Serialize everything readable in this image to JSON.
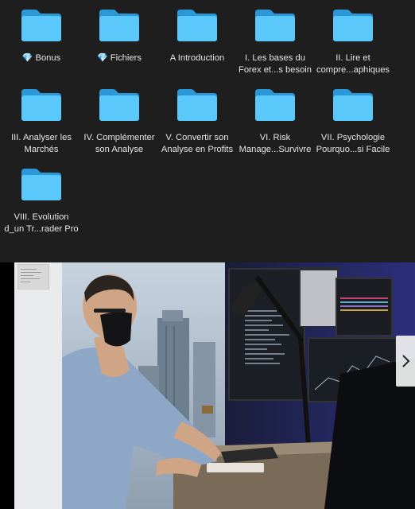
{
  "folders": [
    {
      "prefix": "💎",
      "line1": "Bonus",
      "line2": ""
    },
    {
      "prefix": "💎",
      "line1": "Fichiers",
      "line2": ""
    },
    {
      "prefix": "",
      "line1": "A Introduction",
      "line2": ""
    },
    {
      "prefix": "",
      "line1": "I. Les bases du",
      "line2": "Forex et...s besoin"
    },
    {
      "prefix": "",
      "line1": "II. Lire et",
      "line2": "compre...aphiques"
    },
    {
      "prefix": "",
      "line1": "III. Analyser les",
      "line2": "Marchés"
    },
    {
      "prefix": "",
      "line1": "IV. Complémenter",
      "line2": "son Analyse"
    },
    {
      "prefix": "",
      "line1": "V. Convertir son",
      "line2": "Analyse en Profits"
    },
    {
      "prefix": "",
      "line1": "VI. Risk",
      "line2": "Manage...Survivre"
    },
    {
      "prefix": "",
      "line1": "VII. Psychologie",
      "line2": "Pourquo...si Facile"
    },
    {
      "prefix": "",
      "line1": "VIII. Evolution",
      "line2": "d_un Tr...rader Pro"
    }
  ],
  "icons": {
    "folder": "folder-icon",
    "gem": "gem-icon",
    "next": "chevron-right-icon"
  },
  "colors": {
    "background": "#1e1e1e",
    "text": "#e6e6e6",
    "folder": "#5ac8fa"
  }
}
